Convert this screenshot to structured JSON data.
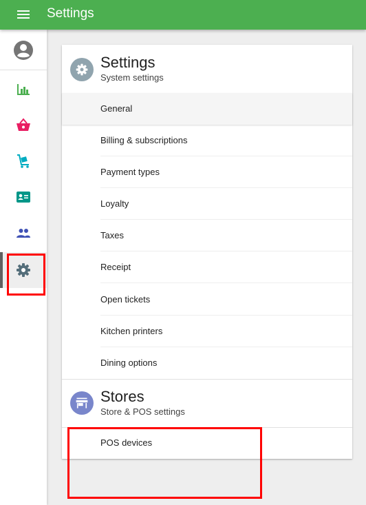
{
  "topbar": {
    "title": "Settings",
    "menu_icon": "menu-icon"
  },
  "sidebar": {
    "items": [
      {
        "name": "avatar",
        "icon": "account-circle-icon",
        "color": "#757575"
      },
      {
        "name": "reports",
        "icon": "bar-chart-icon",
        "color": "#4caf50"
      },
      {
        "name": "items",
        "icon": "basket-icon",
        "color": "#e91e63"
      },
      {
        "name": "inventory",
        "icon": "cart-icon",
        "color": "#00acc1"
      },
      {
        "name": "customers",
        "icon": "contact-card-icon",
        "color": "#009688"
      },
      {
        "name": "employees",
        "icon": "people-icon",
        "color": "#3f51b5"
      },
      {
        "name": "settings",
        "icon": "gear-icon",
        "color": "#546e7a",
        "active": true
      }
    ]
  },
  "settings_section": {
    "title": "Settings",
    "subtitle": "System settings",
    "icon": "gear-icon",
    "icon_bg": "#90a4ae",
    "items": [
      {
        "label": "General",
        "selected": true
      },
      {
        "label": "Billing & subscriptions"
      },
      {
        "label": "Payment types"
      },
      {
        "label": "Loyalty"
      },
      {
        "label": "Taxes"
      },
      {
        "label": "Receipt"
      },
      {
        "label": "Open tickets"
      },
      {
        "label": "Kitchen printers"
      },
      {
        "label": "Dining options"
      }
    ]
  },
  "stores_section": {
    "title": "Stores",
    "subtitle": "Store & POS settings",
    "icon": "store-icon",
    "icon_bg": "#7986cb",
    "items": [
      {
        "label": "POS devices"
      }
    ]
  },
  "colors": {
    "appbar": "#4caf50",
    "highlight": "#ff0000"
  }
}
